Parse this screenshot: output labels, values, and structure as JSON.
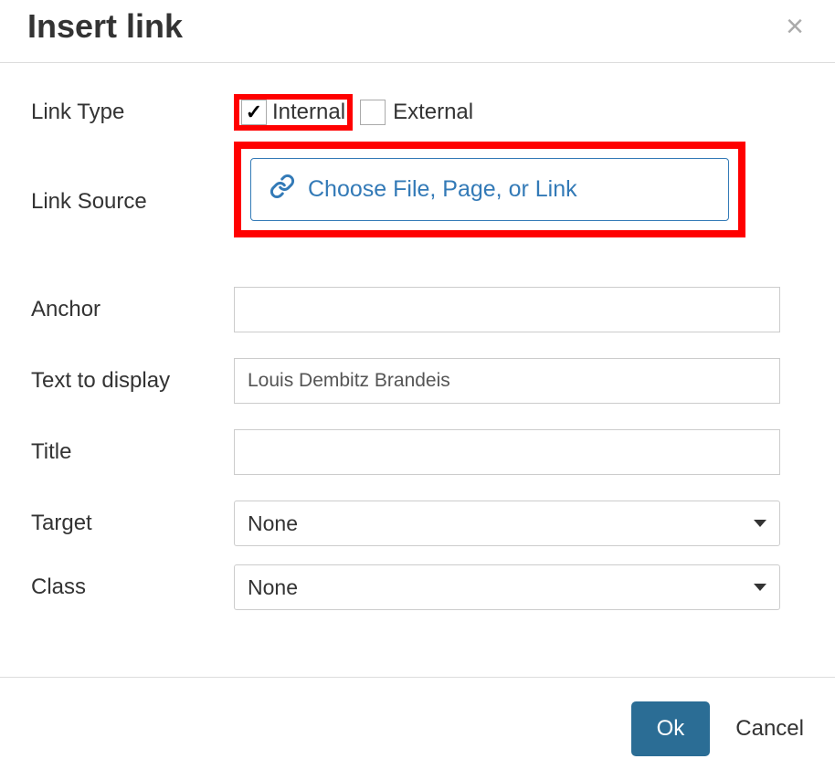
{
  "dialog": {
    "title": "Insert link"
  },
  "labels": {
    "link_type": "Link Type",
    "link_source": "Link Source",
    "anchor": "Anchor",
    "text_to_display": "Text to display",
    "title": "Title",
    "target": "Target",
    "class": "Class"
  },
  "link_type": {
    "internal": {
      "label": "Internal",
      "checked": true
    },
    "external": {
      "label": "External",
      "checked": false
    }
  },
  "link_source": {
    "button_label": "Choose File, Page, or Link"
  },
  "fields": {
    "anchor": "",
    "text_to_display": "Louis Dembitz Brandeis",
    "title": "",
    "target": "None",
    "class": "None"
  },
  "footer": {
    "ok": "Ok",
    "cancel": "Cancel"
  }
}
